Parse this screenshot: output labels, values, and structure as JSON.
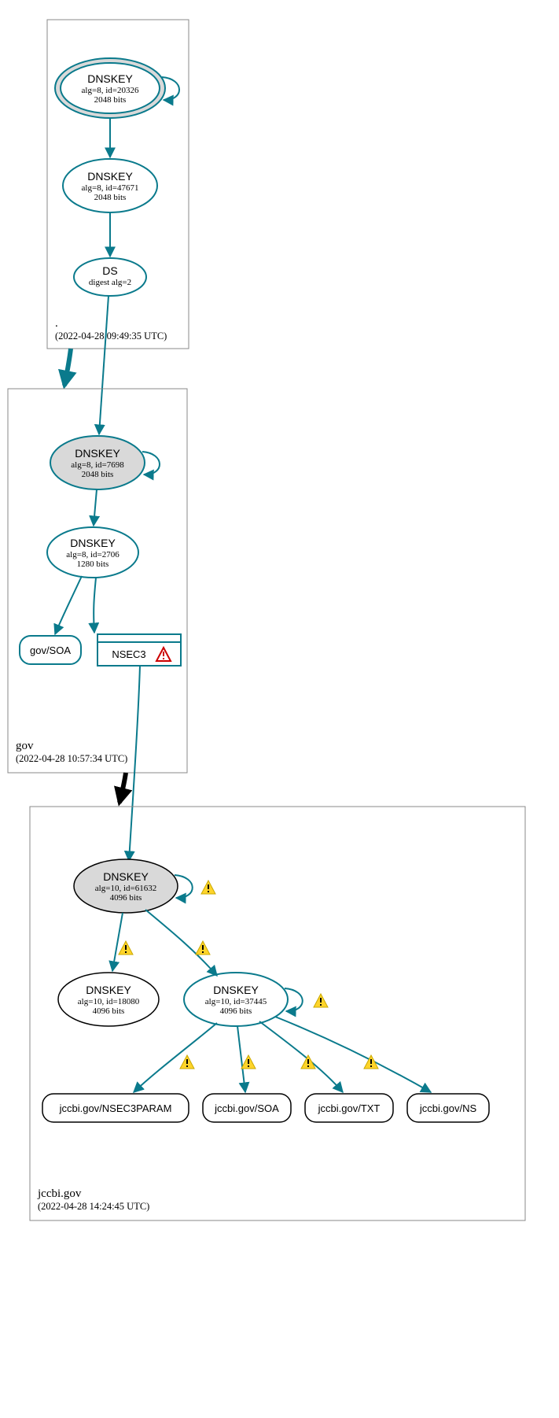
{
  "zones": {
    "root": {
      "label": ".",
      "timestamp": "(2022-04-28 09:49:35 UTC)",
      "nodes": {
        "ksk": {
          "title": "DNSKEY",
          "line1": "alg=8, id=20326",
          "line2": "2048 bits"
        },
        "zsk": {
          "title": "DNSKEY",
          "line1": "alg=8, id=47671",
          "line2": "2048 bits"
        },
        "ds": {
          "title": "DS",
          "line1": "digest alg=2"
        }
      }
    },
    "gov": {
      "label": "gov",
      "timestamp": "(2022-04-28 10:57:34 UTC)",
      "nodes": {
        "ksk": {
          "title": "DNSKEY",
          "line1": "alg=8, id=7698",
          "line2": "2048 bits"
        },
        "zsk": {
          "title": "DNSKEY",
          "line1": "alg=8, id=2706",
          "line2": "1280 bits"
        },
        "soa": {
          "label": "gov/SOA"
        },
        "nsec3": {
          "label": "NSEC3"
        }
      }
    },
    "jccbi": {
      "label": "jccbi.gov",
      "timestamp": "(2022-04-28 14:24:45 UTC)",
      "nodes": {
        "ksk": {
          "title": "DNSKEY",
          "line1": "alg=10, id=61632",
          "line2": "4096 bits"
        },
        "zsk1": {
          "title": "DNSKEY",
          "line1": "alg=10, id=18080",
          "line2": "4096 bits"
        },
        "zsk2": {
          "title": "DNSKEY",
          "line1": "alg=10, id=37445",
          "line2": "4096 bits"
        },
        "nsec3param": {
          "label": "jccbi.gov/NSEC3PARAM"
        },
        "soa": {
          "label": "jccbi.gov/SOA"
        },
        "txt": {
          "label": "jccbi.gov/TXT"
        },
        "ns": {
          "label": "jccbi.gov/NS"
        }
      }
    }
  },
  "colors": {
    "teal": "#0a7a8c",
    "grayFill": "#d9d9d9"
  }
}
